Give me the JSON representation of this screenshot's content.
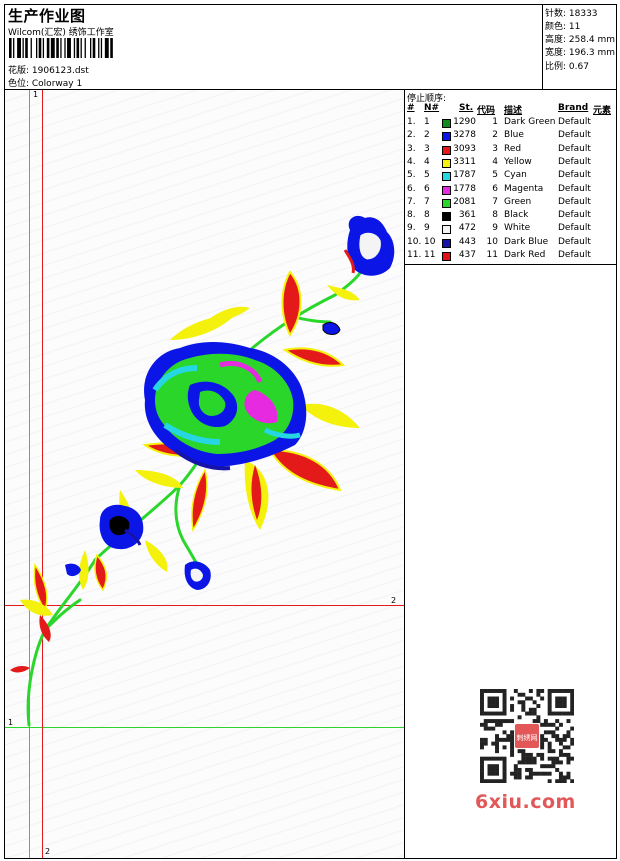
{
  "header": {
    "title": "生产作业图",
    "company": "Wilcom(汇宏) 绣饰工作室",
    "design": "花版: 1906123.dst",
    "colorway": "色位: Colorway 1"
  },
  "stats": {
    "stitches": "针数: 18333",
    "colors": "颜色: 11",
    "height": "高度: 258.4 mm",
    "width": "宽度: 196.3 mm",
    "scale": "比例: 0.67"
  },
  "stop_sequence": {
    "title": "停止顺序:",
    "headers": [
      "#",
      "N#",
      "St.",
      "代码",
      "描述",
      "Brand",
      "元素"
    ],
    "rows": [
      {
        "num": "1.",
        "n": "1",
        "color": "#138a1e",
        "st": "1290",
        "code": "1",
        "desc": "Dark Green",
        "brand": "Default"
      },
      {
        "num": "2.",
        "n": "2",
        "color": "#0b16e6",
        "st": "3278",
        "code": "2",
        "desc": "Blue",
        "brand": "Default"
      },
      {
        "num": "3.",
        "n": "3",
        "color": "#e41a1a",
        "st": "3093",
        "code": "3",
        "desc": "Red",
        "brand": "Default"
      },
      {
        "num": "4.",
        "n": "4",
        "color": "#f4f20c",
        "st": "3311",
        "code": "4",
        "desc": "Yellow",
        "brand": "Default"
      },
      {
        "num": "5.",
        "n": "5",
        "color": "#26d6e0",
        "st": "1787",
        "code": "5",
        "desc": "Cyan",
        "brand": "Default"
      },
      {
        "num": "6.",
        "n": "6",
        "color": "#e62ae0",
        "st": "1778",
        "code": "6",
        "desc": "Magenta",
        "brand": "Default"
      },
      {
        "num": "7.",
        "n": "7",
        "color": "#2bd62b",
        "st": "2081",
        "code": "7",
        "desc": "Green",
        "brand": "Default"
      },
      {
        "num": "8.",
        "n": "8",
        "color": "#000000",
        "st": "361",
        "code": "8",
        "desc": "Black",
        "brand": "Default"
      },
      {
        "num": "9.",
        "n": "9",
        "color": "#f4f4f4",
        "st": "472",
        "code": "9",
        "desc": "White",
        "brand": "Default"
      },
      {
        "num": "10.",
        "n": "10",
        "color": "#1614a8",
        "st": "443",
        "code": "10",
        "desc": "Dark Blue",
        "brand": "Default"
      },
      {
        "num": "11.",
        "n": "11",
        "color": "#e01414",
        "st": "437",
        "code": "11",
        "desc": "Dark Red",
        "brand": "Default"
      }
    ]
  },
  "guides": {
    "label_green_top": "1",
    "label_green_left": "1",
    "label_red_right": "2",
    "label_red_bottom": "2"
  },
  "watermark": {
    "text": "6xiu.com",
    "qr_badge": "刺绣网"
  }
}
